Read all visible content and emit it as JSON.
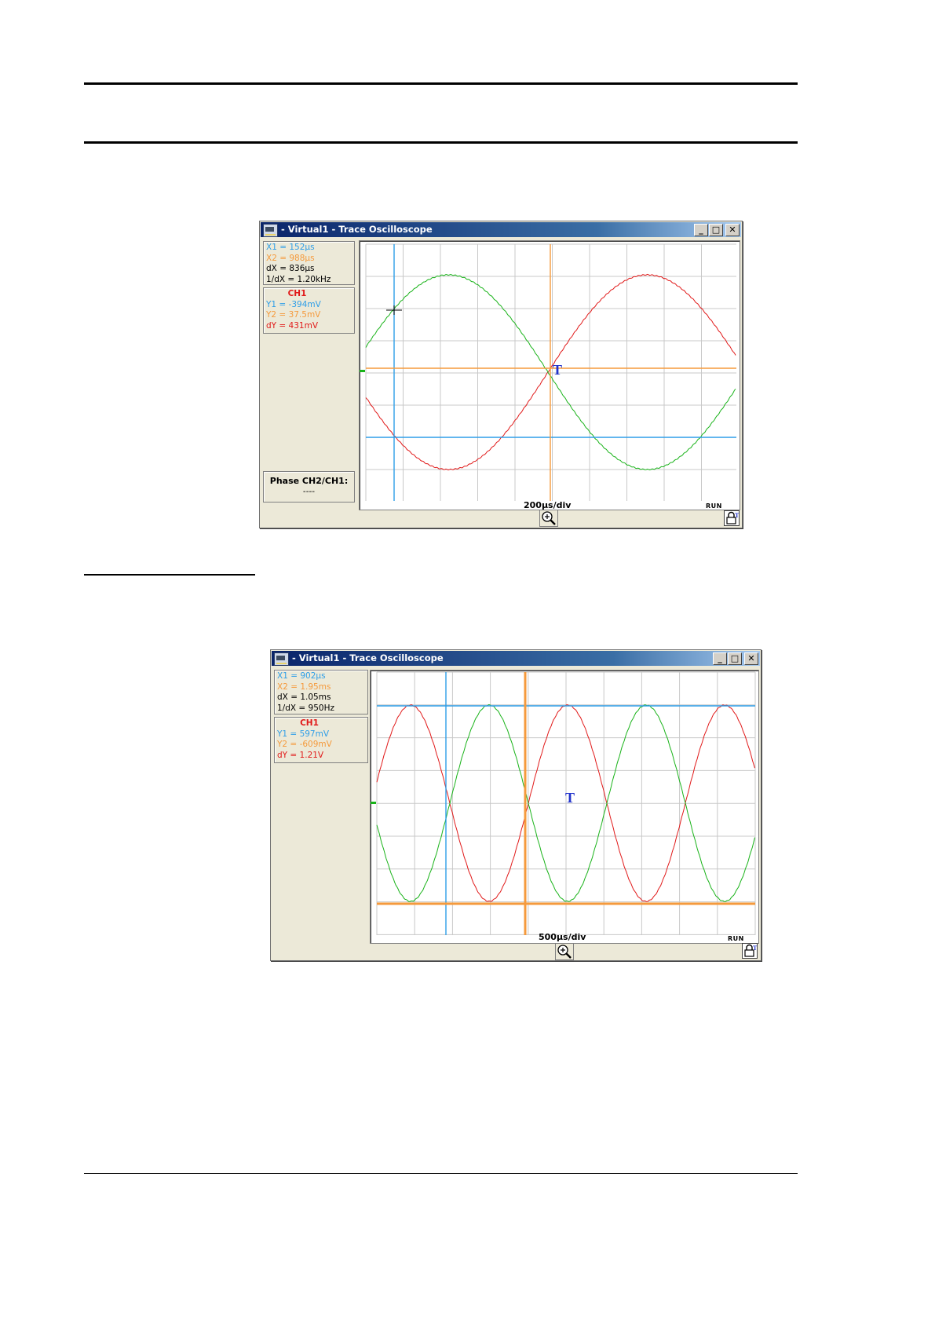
{
  "windows": [
    {
      "title": "- Virtual1 - Trace Oscilloscope",
      "cursors": {
        "x1": "X1 = 152µs",
        "x2": "X2 = 988µs",
        "dx": "dX = 836µs",
        "inv_dx": "1/dX = 1.20kHz"
      },
      "channel": {
        "name": "CH1",
        "y1": "Y1 = -394mV",
        "y2": "Y2 = 37.5mV",
        "dy": "dY = 431mV"
      },
      "phase": {
        "label": "Phase CH2/CH1:",
        "value": "----"
      },
      "timebase": "200µs/div",
      "status": "RUN",
      "trigger": "T",
      "colors": {
        "ch1": "#e11919",
        "ch2": "#19b319",
        "cursor1": "#2e9ee8",
        "cursor2": "#f59a3c"
      }
    },
    {
      "title": "- Virtual1 - Trace Oscilloscope",
      "cursors": {
        "x1": "X1 = 902µs",
        "x2": "X2 = 1.95ms",
        "dx": "dX = 1.05ms",
        "inv_dx": "1/dX = 950Hz"
      },
      "channel": {
        "name": "CH1",
        "y1": "Y1 = 597mV",
        "y2": "Y2 = -609mV",
        "dy": "dY = 1.21V"
      },
      "timebase": "500µs/div",
      "status": "RUN",
      "trigger": "T",
      "colors": {
        "ch1": "#e11919",
        "ch2": "#19b319",
        "cursor1": "#2e9ee8",
        "cursor2": "#f59a3c"
      }
    }
  ]
}
